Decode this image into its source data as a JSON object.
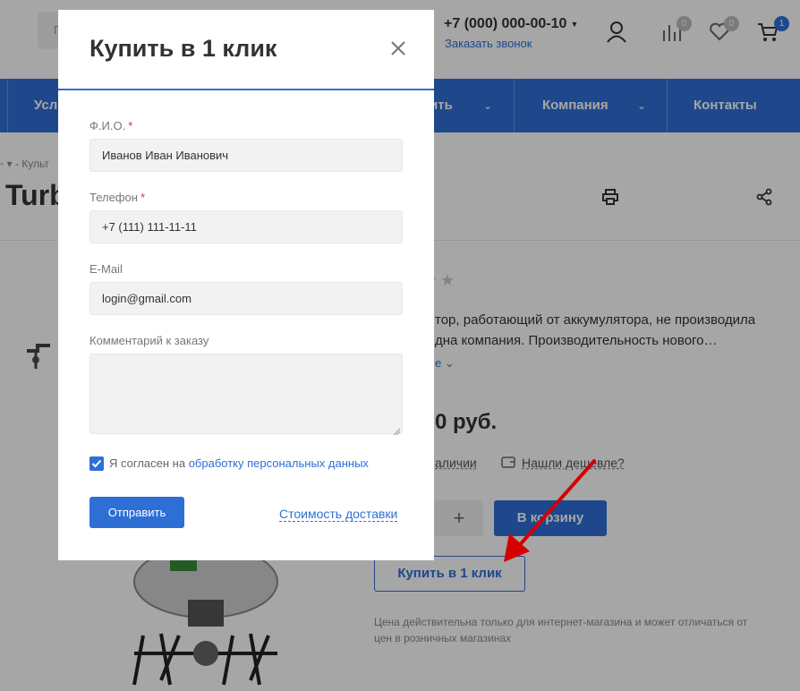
{
  "header": {
    "search_placeholder": "П",
    "phone": "+7 (000) 000-00-10",
    "callback": "Заказать звонок",
    "compare_count": "0",
    "favorites_count": "0",
    "cart_count": "1",
    "icons": [
      "user-icon",
      "compare-icon",
      "heart-icon",
      "cart-icon"
    ]
  },
  "nav": {
    "items": [
      "Усл",
      "ить",
      "Компания",
      "Контакты"
    ]
  },
  "page": {
    "breadcrumbs": "◦  ▾  -  Культ",
    "title": "Turb",
    "desc_line1": "тор, работающий от аккумулятора, не производила",
    "desc_line2": "дна компания. Производительность нового…",
    "more": "е",
    "price": "0 руб.",
    "availability": "аличии",
    "cheaper": "Нашли дешевле?",
    "qty_plus": "+",
    "cart_button": "В корзину",
    "oneclick_button": "Купить в 1 клик",
    "disclaimer": "Цена действительна только для интернет-магазина и может отличаться от цен в розничных магазинах"
  },
  "modal": {
    "title": "Купить в 1 клик",
    "name_label": "Ф.И.О.",
    "name_value": "Иванов Иван Иванович",
    "phone_label": "Телефон",
    "phone_value": "+7 (111) 111-11-11",
    "email_label": "E-Mail",
    "email_value": "login@gmail.com",
    "comment_label": "Комментарий к заказу",
    "required_mark": "*",
    "agree_text": "Я согласен на ",
    "agree_link": "обработку персональных данных",
    "submit": "Отправить",
    "delivery_link": "Стоимость доставки"
  },
  "colors": {
    "accent": "#2e6fd6",
    "required": "#e03131",
    "arrow": "#d40000"
  }
}
